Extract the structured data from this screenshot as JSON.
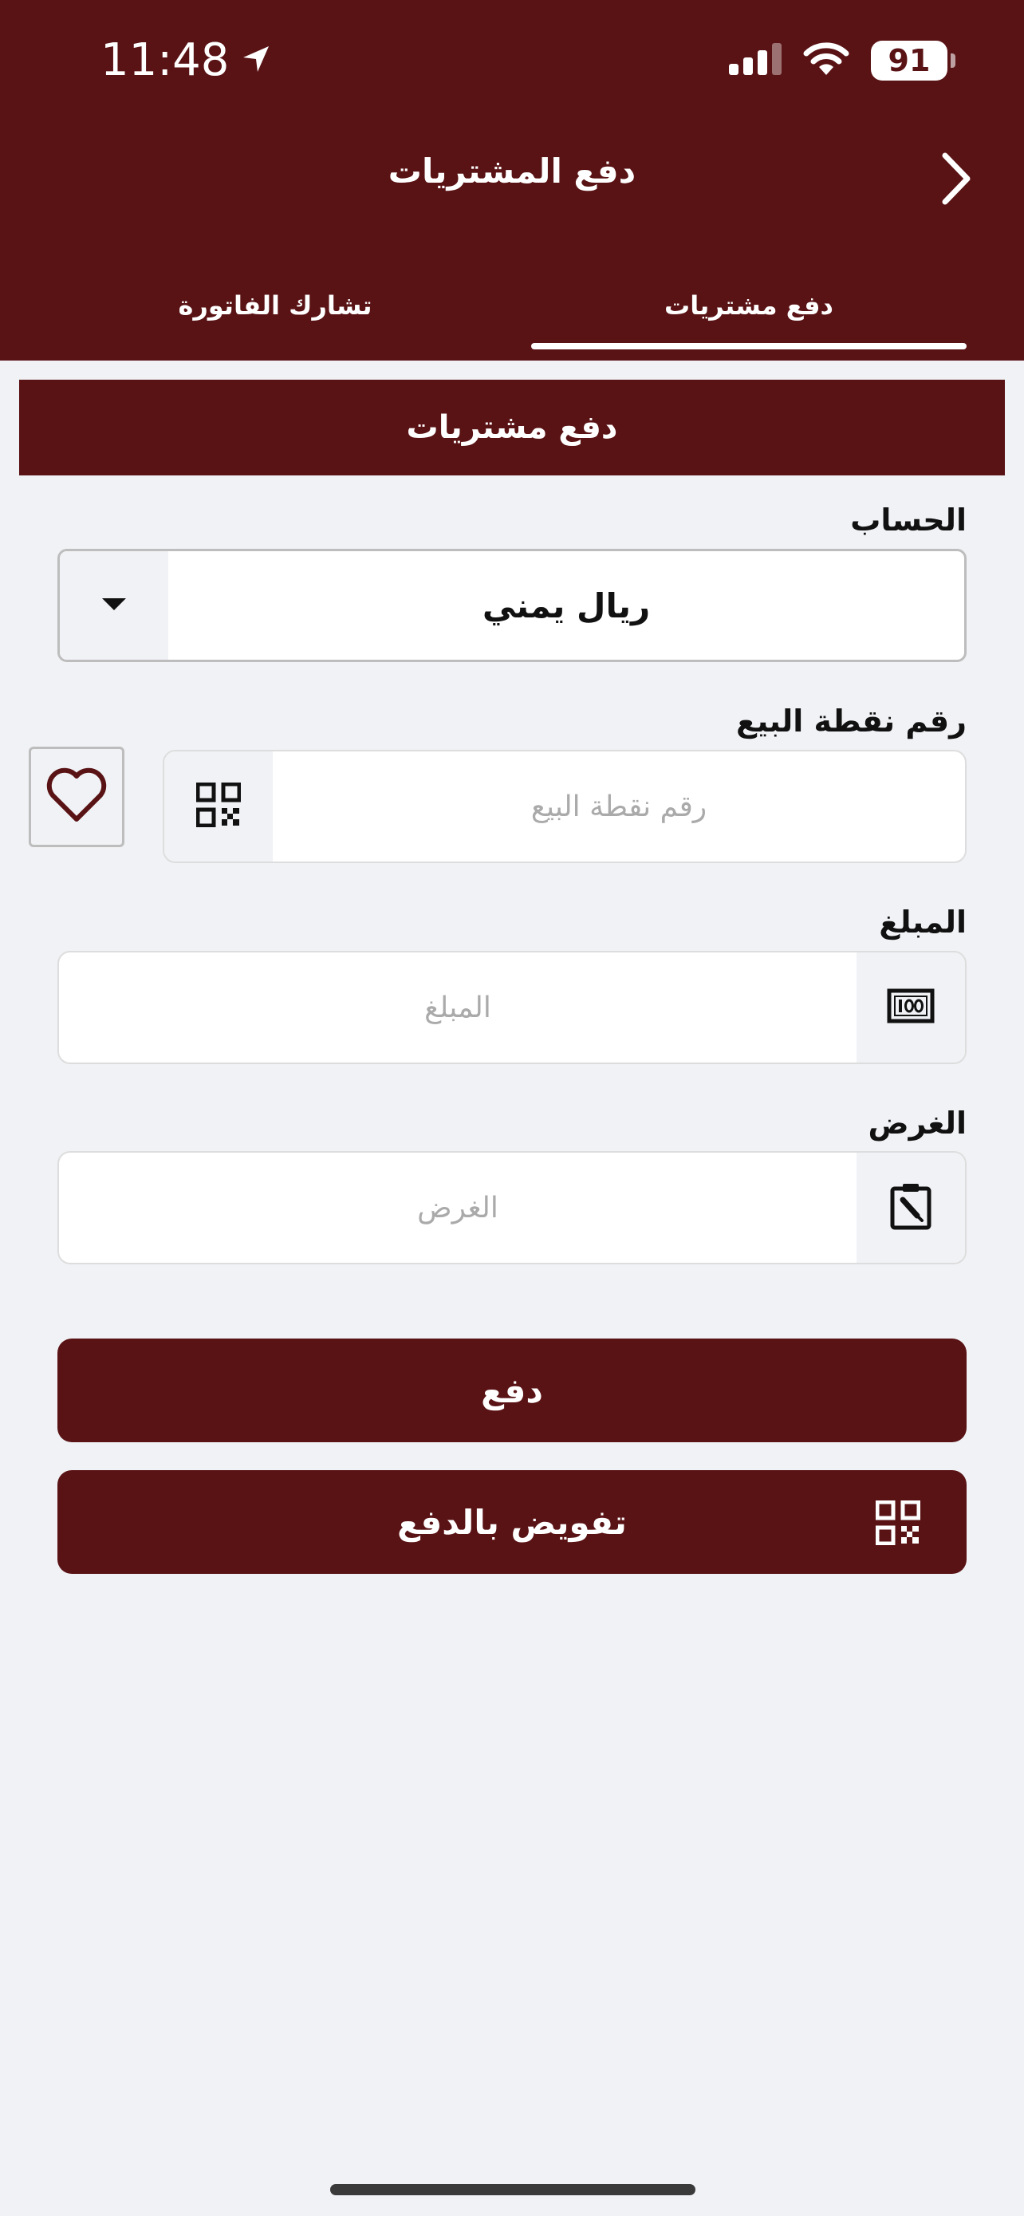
{
  "status_bar": {
    "time": "11:48",
    "battery": "91"
  },
  "header": {
    "title": "دفع المشتريات"
  },
  "tabs": [
    {
      "label": "دفع مشتريات",
      "active": true
    },
    {
      "label": "تشارك  الفاتورة",
      "active": false
    }
  ],
  "section": {
    "title": "دفع مشتريات"
  },
  "form": {
    "account": {
      "label": "الحساب",
      "value": "ريال يمني"
    },
    "pos_number": {
      "label": "رقم نقطة البيع",
      "placeholder": "رقم نقطة البيع"
    },
    "amount": {
      "label": "المبلغ",
      "placeholder": "المبلغ"
    },
    "purpose": {
      "label": "الغرض",
      "placeholder": "الغرض"
    }
  },
  "buttons": {
    "pay": "دفع",
    "authorize": "تفويض بالدفع"
  },
  "colors": {
    "brand": "#5a1315",
    "background": "#f0f2f5"
  },
  "icons": [
    "location-arrow-icon",
    "signal-icon",
    "wifi-icon",
    "chevron-right-icon",
    "dropdown-caret-icon",
    "qr-code-icon",
    "heart-icon",
    "money-icon",
    "clipboard-edit-icon"
  ]
}
